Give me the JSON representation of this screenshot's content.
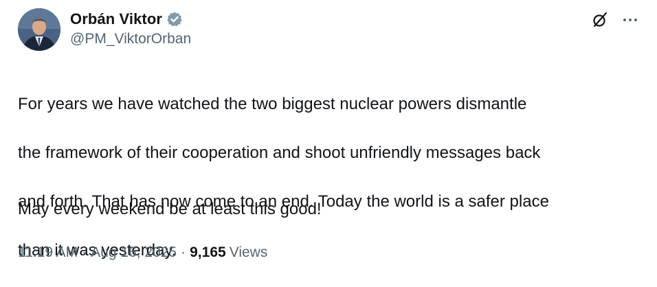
{
  "author": {
    "name": "Orbán Viktor",
    "handle": "@PM_ViktorOrban",
    "verified": true
  },
  "actions": {
    "grok_icon": "grok-slash-icon",
    "more_icon": "more-horizontal-icon"
  },
  "tweet": {
    "paragraph1_lines": [
      "For years we have watched the two biggest nuclear powers dismantle",
      "the framework of their cooperation and shoot unfriendly messages back",
      "and forth. That has now come to an end. Today the world is a safer place",
      "than it was yesterday."
    ],
    "paragraph2": "May every weekend be at least this good!"
  },
  "meta": {
    "time": "11:19 AM",
    "separator": "·",
    "date": "Aug 16, 2025",
    "views_count": "9,165",
    "views_label": "Views"
  },
  "colors": {
    "text_primary": "#0f1419",
    "text_secondary": "#536471",
    "verified_badge": "#829aab"
  }
}
